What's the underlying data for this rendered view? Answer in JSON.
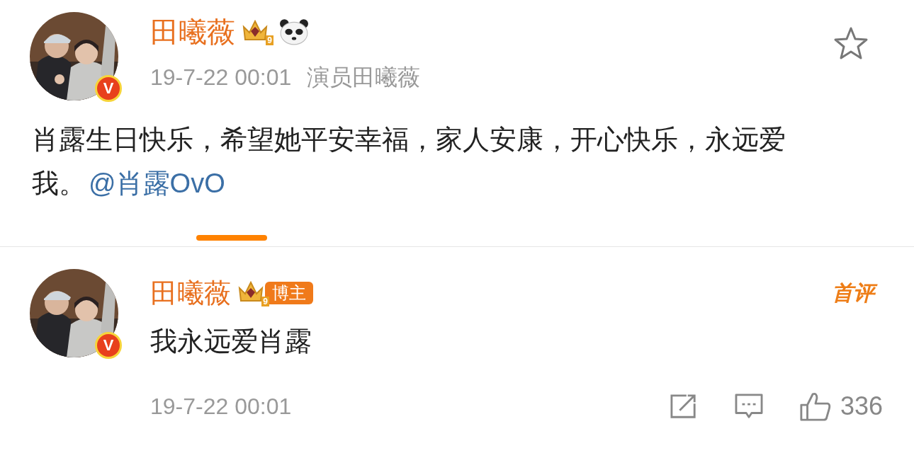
{
  "post": {
    "author": {
      "name": "田曦薇",
      "verified_mark": "V",
      "crown_badge_text": "9"
    },
    "time": "19-7-22 00:01",
    "source": "演员田曦薇",
    "starred": false,
    "text": "肖露生日快乐，希望她平安幸福，家人安康，开心快乐，永远爱我。",
    "mention": "@肖露OvO"
  },
  "comment": {
    "author": {
      "name": "田曦薇",
      "verified_mark": "V",
      "crown_badge_text": "9",
      "role_badge": "博主"
    },
    "first_comment_badge": "首评",
    "text": "我永远爱肖露",
    "time": "19-7-22 00:01",
    "likes": "336"
  }
}
